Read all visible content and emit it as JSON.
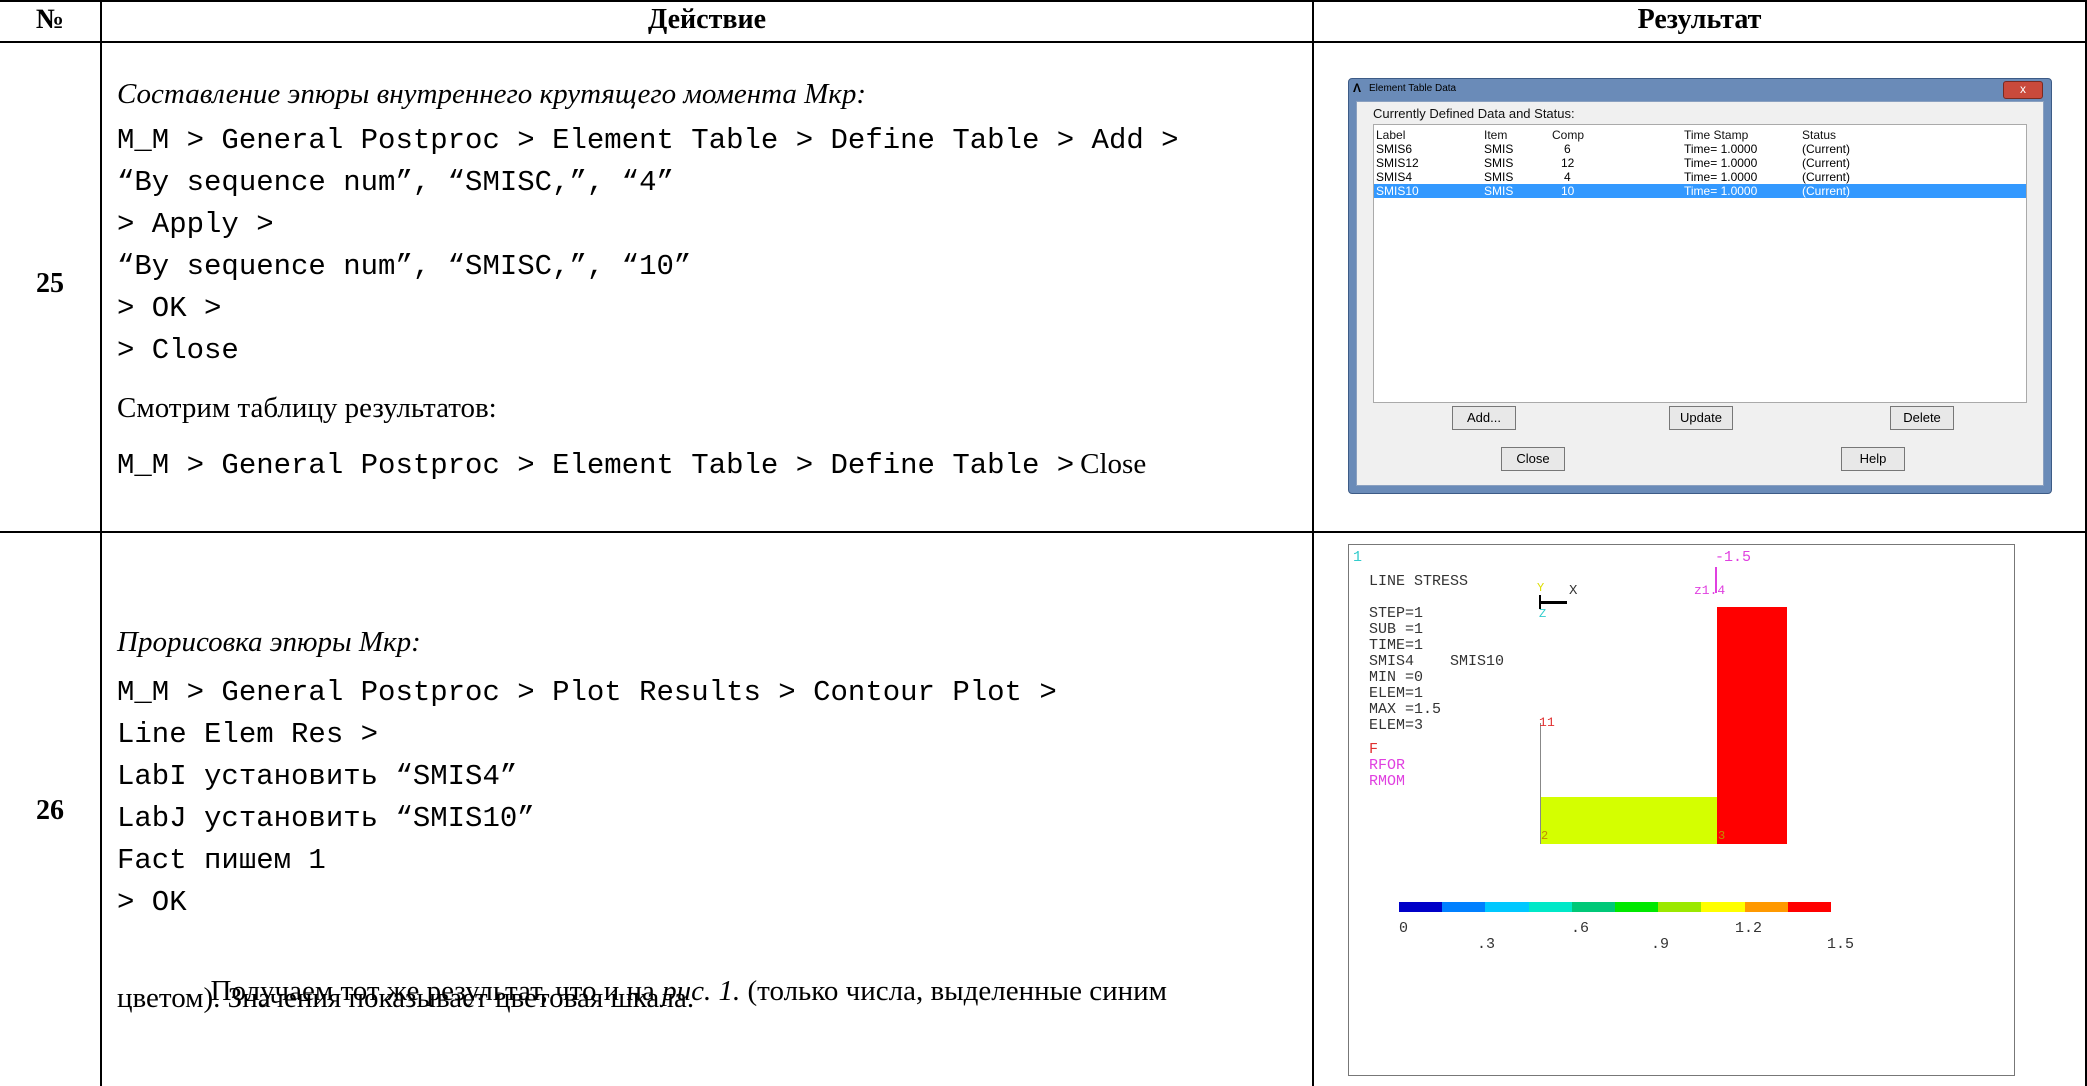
{
  "table": {
    "headers": {
      "num": "№",
      "action": "Действие",
      "result": "Результат"
    },
    "rows": [
      {
        "num": "25",
        "lines": [
          "Составление эпюры внутреннего крутящего момента Мкр:",
          "M_M > General Postproc > Element Table > Define Table > Add >",
          "“By sequence num”, “SMISC,”, “4”",
          "> Apply >",
          "“By sequence num”, “SMISC,”, “10”",
          "> OK >",
          "> Close",
          "Смотрим таблицу результатов:",
          "M_M > General Postproc > Element Table > Define Table >",
          "Close"
        ]
      },
      {
        "num": "26",
        "lines": [
          "Прорисовка эпюры Мкр:",
          "M_M > General Postproc > Plot Results > Contour Plot >",
          "Line Elem Res >",
          "LabI установить “SMIS4”",
          "LabJ установить “SMIS10”",
          "Fact пишем 1",
          "> OK",
          "Получаем тот же результат, что и на ",
          "рис. 1.",
          " (только числа, выделенные синим",
          "цветом). Значения показывает цветовая шкала."
        ]
      }
    ]
  },
  "dialog": {
    "title": "Element Table Data",
    "close_icon": "x",
    "subtitle": "Currently Defined Data and Status:",
    "columns": [
      "Label",
      "Item",
      "Comp",
      "Time Stamp",
      "Status"
    ],
    "rows": [
      [
        "SMIS6",
        "SMIS",
        "6",
        "Time= 1.0000",
        "(Current)"
      ],
      [
        "SMIS12",
        "SMIS",
        "12",
        "Time= 1.0000",
        "(Current)"
      ],
      [
        "SMIS4",
        "SMIS",
        "4",
        "Time= 1.0000",
        "(Current)"
      ],
      [
        "SMIS10",
        "SMIS",
        "10",
        "Time= 1.0000",
        "(Current)"
      ]
    ],
    "selected_row": 3,
    "buttons": {
      "add": "Add...",
      "update": "Update",
      "delete": "Delete",
      "close": "Close",
      "help": "Help"
    }
  },
  "plot": {
    "corner_number": "1",
    "title": "LINE STRESS",
    "info": [
      "STEP=1",
      "SUB =1",
      "TIME=1",
      "SMIS4    SMIS10",
      "MIN =0",
      "ELEM=1",
      "MAX =1.5",
      "ELEM=3"
    ],
    "legend_items": [
      "F",
      "RFOR",
      "RMOM"
    ],
    "axis_labels": {
      "y": "Y",
      "x": "X",
      "z": "Z"
    },
    "max_label": "-1.5",
    "node_labels": [
      "z1.4",
      "1",
      "1",
      "2",
      "3"
    ],
    "colorbar_colors": [
      "#0000c8",
      "#0080ff",
      "#00c8ff",
      "#00e8c8",
      "#00c878",
      "#00e800",
      "#9be800",
      "#ffff00",
      "#ff9900",
      "#ff0000"
    ],
    "scale_top": [
      "0",
      ".6",
      "1.2"
    ],
    "scale_bottom": [
      ".3",
      ".9",
      "1.5"
    ],
    "fill_colors": {
      "low": "#d4ff00",
      "high": "#ff0000"
    }
  }
}
